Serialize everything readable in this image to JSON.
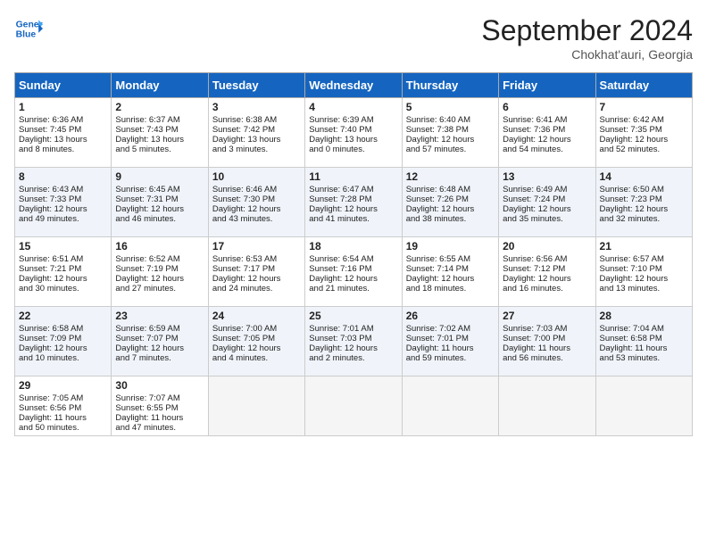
{
  "header": {
    "logo_line1": "General",
    "logo_line2": "Blue",
    "month": "September 2024",
    "location": "Chokhat'auri, Georgia"
  },
  "days_of_week": [
    "Sunday",
    "Monday",
    "Tuesday",
    "Wednesday",
    "Thursday",
    "Friday",
    "Saturday"
  ],
  "weeks": [
    [
      {
        "day": 1,
        "lines": [
          "Sunrise: 6:36 AM",
          "Sunset: 7:45 PM",
          "Daylight: 13 hours",
          "and 8 minutes."
        ]
      },
      {
        "day": 2,
        "lines": [
          "Sunrise: 6:37 AM",
          "Sunset: 7:43 PM",
          "Daylight: 13 hours",
          "and 5 minutes."
        ]
      },
      {
        "day": 3,
        "lines": [
          "Sunrise: 6:38 AM",
          "Sunset: 7:42 PM",
          "Daylight: 13 hours",
          "and 3 minutes."
        ]
      },
      {
        "day": 4,
        "lines": [
          "Sunrise: 6:39 AM",
          "Sunset: 7:40 PM",
          "Daylight: 13 hours",
          "and 0 minutes."
        ]
      },
      {
        "day": 5,
        "lines": [
          "Sunrise: 6:40 AM",
          "Sunset: 7:38 PM",
          "Daylight: 12 hours",
          "and 57 minutes."
        ]
      },
      {
        "day": 6,
        "lines": [
          "Sunrise: 6:41 AM",
          "Sunset: 7:36 PM",
          "Daylight: 12 hours",
          "and 54 minutes."
        ]
      },
      {
        "day": 7,
        "lines": [
          "Sunrise: 6:42 AM",
          "Sunset: 7:35 PM",
          "Daylight: 12 hours",
          "and 52 minutes."
        ]
      }
    ],
    [
      {
        "day": 8,
        "lines": [
          "Sunrise: 6:43 AM",
          "Sunset: 7:33 PM",
          "Daylight: 12 hours",
          "and 49 minutes."
        ]
      },
      {
        "day": 9,
        "lines": [
          "Sunrise: 6:45 AM",
          "Sunset: 7:31 PM",
          "Daylight: 12 hours",
          "and 46 minutes."
        ]
      },
      {
        "day": 10,
        "lines": [
          "Sunrise: 6:46 AM",
          "Sunset: 7:30 PM",
          "Daylight: 12 hours",
          "and 43 minutes."
        ]
      },
      {
        "day": 11,
        "lines": [
          "Sunrise: 6:47 AM",
          "Sunset: 7:28 PM",
          "Daylight: 12 hours",
          "and 41 minutes."
        ]
      },
      {
        "day": 12,
        "lines": [
          "Sunrise: 6:48 AM",
          "Sunset: 7:26 PM",
          "Daylight: 12 hours",
          "and 38 minutes."
        ]
      },
      {
        "day": 13,
        "lines": [
          "Sunrise: 6:49 AM",
          "Sunset: 7:24 PM",
          "Daylight: 12 hours",
          "and 35 minutes."
        ]
      },
      {
        "day": 14,
        "lines": [
          "Sunrise: 6:50 AM",
          "Sunset: 7:23 PM",
          "Daylight: 12 hours",
          "and 32 minutes."
        ]
      }
    ],
    [
      {
        "day": 15,
        "lines": [
          "Sunrise: 6:51 AM",
          "Sunset: 7:21 PM",
          "Daylight: 12 hours",
          "and 30 minutes."
        ]
      },
      {
        "day": 16,
        "lines": [
          "Sunrise: 6:52 AM",
          "Sunset: 7:19 PM",
          "Daylight: 12 hours",
          "and 27 minutes."
        ]
      },
      {
        "day": 17,
        "lines": [
          "Sunrise: 6:53 AM",
          "Sunset: 7:17 PM",
          "Daylight: 12 hours",
          "and 24 minutes."
        ]
      },
      {
        "day": 18,
        "lines": [
          "Sunrise: 6:54 AM",
          "Sunset: 7:16 PM",
          "Daylight: 12 hours",
          "and 21 minutes."
        ]
      },
      {
        "day": 19,
        "lines": [
          "Sunrise: 6:55 AM",
          "Sunset: 7:14 PM",
          "Daylight: 12 hours",
          "and 18 minutes."
        ]
      },
      {
        "day": 20,
        "lines": [
          "Sunrise: 6:56 AM",
          "Sunset: 7:12 PM",
          "Daylight: 12 hours",
          "and 16 minutes."
        ]
      },
      {
        "day": 21,
        "lines": [
          "Sunrise: 6:57 AM",
          "Sunset: 7:10 PM",
          "Daylight: 12 hours",
          "and 13 minutes."
        ]
      }
    ],
    [
      {
        "day": 22,
        "lines": [
          "Sunrise: 6:58 AM",
          "Sunset: 7:09 PM",
          "Daylight: 12 hours",
          "and 10 minutes."
        ]
      },
      {
        "day": 23,
        "lines": [
          "Sunrise: 6:59 AM",
          "Sunset: 7:07 PM",
          "Daylight: 12 hours",
          "and 7 minutes."
        ]
      },
      {
        "day": 24,
        "lines": [
          "Sunrise: 7:00 AM",
          "Sunset: 7:05 PM",
          "Daylight: 12 hours",
          "and 4 minutes."
        ]
      },
      {
        "day": 25,
        "lines": [
          "Sunrise: 7:01 AM",
          "Sunset: 7:03 PM",
          "Daylight: 12 hours",
          "and 2 minutes."
        ]
      },
      {
        "day": 26,
        "lines": [
          "Sunrise: 7:02 AM",
          "Sunset: 7:01 PM",
          "Daylight: 11 hours",
          "and 59 minutes."
        ]
      },
      {
        "day": 27,
        "lines": [
          "Sunrise: 7:03 AM",
          "Sunset: 7:00 PM",
          "Daylight: 11 hours",
          "and 56 minutes."
        ]
      },
      {
        "day": 28,
        "lines": [
          "Sunrise: 7:04 AM",
          "Sunset: 6:58 PM",
          "Daylight: 11 hours",
          "and 53 minutes."
        ]
      }
    ],
    [
      {
        "day": 29,
        "lines": [
          "Sunrise: 7:05 AM",
          "Sunset: 6:56 PM",
          "Daylight: 11 hours",
          "and 50 minutes."
        ]
      },
      {
        "day": 30,
        "lines": [
          "Sunrise: 7:07 AM",
          "Sunset: 6:55 PM",
          "Daylight: 11 hours",
          "and 47 minutes."
        ]
      },
      null,
      null,
      null,
      null,
      null
    ]
  ]
}
